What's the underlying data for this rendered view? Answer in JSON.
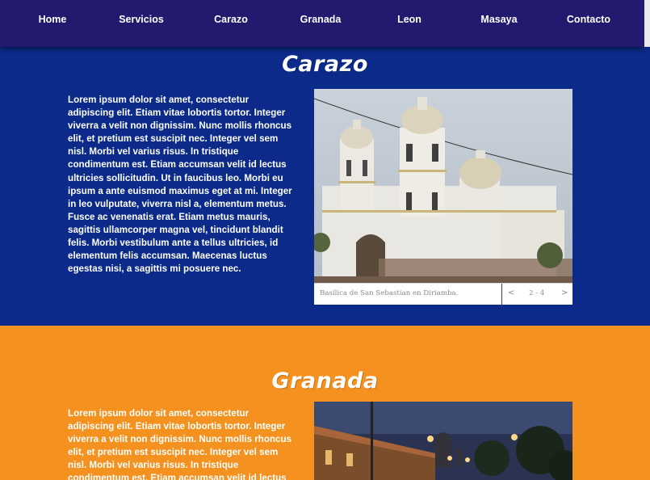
{
  "nav": {
    "items": [
      {
        "label": "Home"
      },
      {
        "label": "Servicios"
      },
      {
        "label": "Carazo"
      },
      {
        "label": "Granada"
      },
      {
        "label": "Leon"
      },
      {
        "label": "Masaya"
      },
      {
        "label": "Contacto"
      }
    ]
  },
  "colors": {
    "nav_bg": "#221a6e",
    "carazo_bg": "#0b2a8a",
    "granada_bg": "#f5911e"
  },
  "carazo": {
    "title": "Carazo",
    "text": "Lorem ipsum dolor sit amet, consectetur adipiscing elit. Etiam vitae lobortis tortor. Integer viverra a velit non dignissim. Nunc mollis rhoncus elit, et pretium est suscipit nec. Integer vel sem nisl. Morbi vel varius risus. In tristique condimentum est. Etiam accumsan velit id lectus ultricies sollicitudin. Ut in faucibus leo. Morbi eu ipsum a ante euismod maximus eget at mi. Integer in leo vulputate, viverra nisl a, elementum metus. Fusce ac venenatis erat. Etiam metus mauris, sagittis ullamcorper magna vel, tincidunt blandit felis. Morbi vestibulum ante a tellus ultricies, id elementum felis accumsan. Maecenas luctus egestas nisi, a sagittis mi posuere nec.",
    "gallery": {
      "caption": "Basilica de San Sebastian en Diriamba.",
      "prev": "<",
      "counter": "2 - 4",
      "next": ">"
    }
  },
  "granada": {
    "title": "Granada",
    "text": "Lorem ipsum dolor sit amet, consectetur adipiscing elit. Etiam vitae lobortis tortor. Integer viverra a velit non dignissim. Nunc mollis rhoncus elit, et pretium est suscipit nec. Integer vel sem nisl. Morbi vel varius risus. In tristique condimentum est. Etiam accumsan velit id lectus ultricies sollicitudin. Ut in"
  }
}
